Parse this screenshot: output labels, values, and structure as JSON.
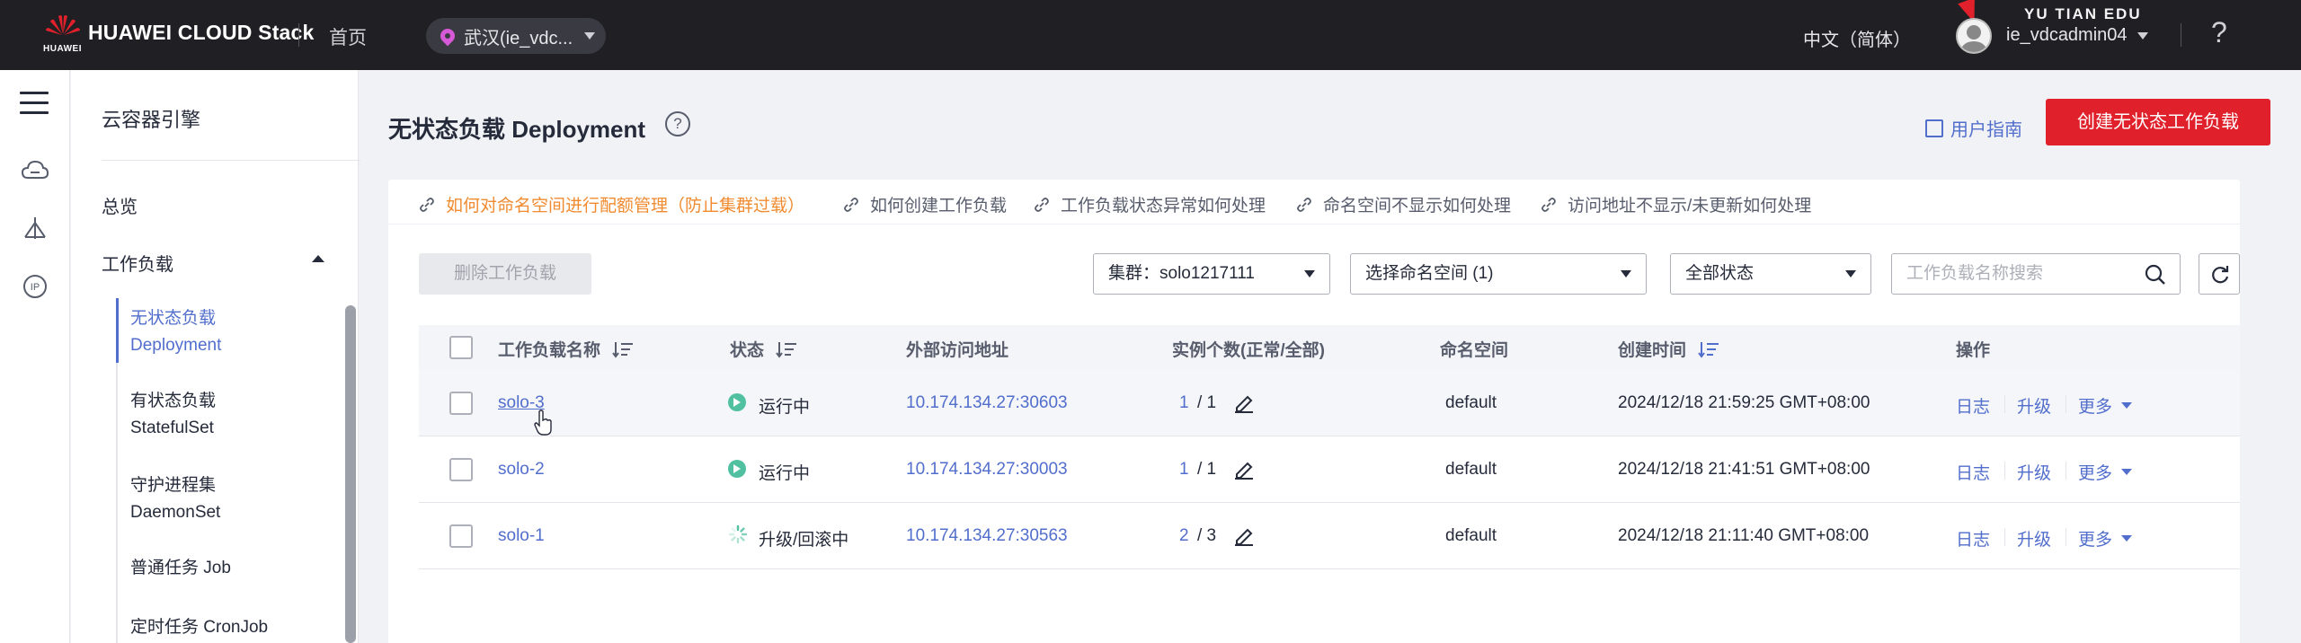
{
  "header": {
    "brand": "HUAWEI CLOUD Stack",
    "brand_sub": "HUAWEI",
    "home": "首页",
    "region": "武汉(ie_vdc...",
    "language": "中文（简体）",
    "user": "ie_vdcadmin04",
    "watermark": "YU TIAN EDU",
    "help_icon": "?"
  },
  "rail": {
    "icons": [
      "menu-icon",
      "cloud-icon",
      "cluster-icon",
      "ip-icon"
    ]
  },
  "sidebar": {
    "title": "云容器引擎",
    "items": [
      {
        "label": "总览"
      },
      {
        "label": "工作负载"
      }
    ],
    "sub_items": [
      {
        "label_cn": "无状态负载",
        "label_en": "Deployment",
        "active": true
      },
      {
        "label_cn": "有状态负载",
        "label_en": "StatefulSet",
        "active": false
      },
      {
        "label_cn": "守护进程集",
        "label_en": "DaemonSet",
        "active": false
      },
      {
        "label_cn": "普通任务 Job",
        "label_en": "",
        "active": false
      },
      {
        "label_cn": "定时任务 CronJob",
        "label_en": "",
        "active": false
      }
    ]
  },
  "main": {
    "title": "无状态负载 Deployment",
    "guide": "用户指南",
    "create_button": "创建无状态工作负载",
    "help_links": [
      "如何对命名空间进行配额管理（防止集群过载）",
      "如何创建工作负载",
      "工作负载状态异常如何处理",
      "命名空间不显示如何处理",
      "访问地址不显示/未更新如何处理"
    ],
    "toolbar": {
      "delete_button": "删除工作负载",
      "cluster_select": "集群：solo1217111",
      "namespace_select": "选择命名空间 (1)",
      "status_select": "全部状态",
      "search_placeholder": "工作负载名称搜索"
    },
    "table": {
      "columns": [
        "工作负载名称",
        "状态",
        "外部访问地址",
        "实例个数(正常/全部)",
        "命名空间",
        "创建时间",
        "操作"
      ],
      "rows": [
        {
          "name": "solo-3",
          "status": "运行中",
          "status_type": "running",
          "address": "10.174.134.27:30603",
          "ready": "1",
          "total": "/ 1",
          "namespace": "default",
          "created": "2024/12/18 21:59:25 GMT+08:00",
          "actions": [
            "日志",
            "升级",
            "更多"
          ]
        },
        {
          "name": "solo-2",
          "status": "运行中",
          "status_type": "running",
          "address": "10.174.134.27:30003",
          "ready": "1",
          "total": "/ 1",
          "namespace": "default",
          "created": "2024/12/18 21:41:51 GMT+08:00",
          "actions": [
            "日志",
            "升级",
            "更多"
          ]
        },
        {
          "name": "solo-1",
          "status": "升级/回滚中",
          "status_type": "upgrading",
          "address": "10.174.134.27:30563",
          "ready": "2",
          "total": "/ 3",
          "namespace": "default",
          "created": "2024/12/18 21:11:40 GMT+08:00",
          "actions": [
            "日志",
            "升级",
            "更多"
          ]
        }
      ]
    }
  },
  "colors": {
    "accent": "#526ecc",
    "brand_red": "#e0202a",
    "running_green": "#50c0a0",
    "warning_orange": "#f08b30"
  }
}
